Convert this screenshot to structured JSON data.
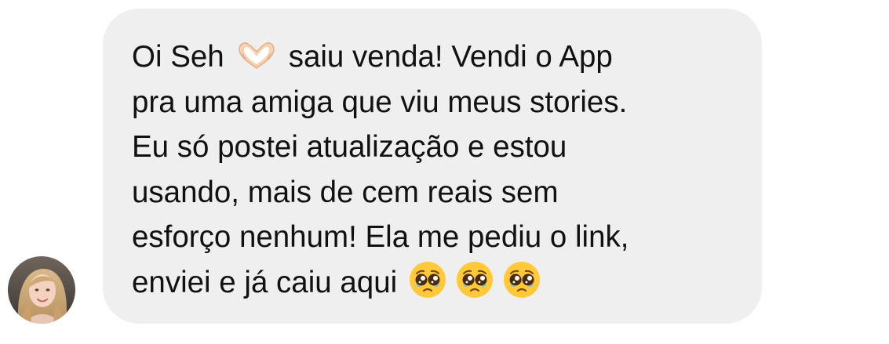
{
  "message": {
    "lines": [
      {
        "segments": [
          {
            "type": "text",
            "value": "Oi Seh"
          },
          {
            "type": "emoji",
            "icon": "heart-hands-icon"
          },
          {
            "type": "text",
            "value": "saiu venda! Vendi o App"
          }
        ]
      },
      {
        "segments": [
          {
            "type": "text",
            "value": "pra uma amiga que viu meus stories."
          }
        ]
      },
      {
        "segments": [
          {
            "type": "text",
            "value": "Eu só postei atualização e estou"
          }
        ]
      },
      {
        "segments": [
          {
            "type": "text",
            "value": "usando, mais de cem reais sem"
          }
        ]
      },
      {
        "segments": [
          {
            "type": "text",
            "value": "esforço nenhum! Ela me pediu o link,"
          }
        ]
      },
      {
        "segments": [
          {
            "type": "text",
            "value": "enviei e já caiu aqui"
          },
          {
            "type": "emoji",
            "icon": "pleading-face-icon"
          },
          {
            "type": "emoji",
            "icon": "pleading-face-icon"
          },
          {
            "type": "emoji",
            "icon": "pleading-face-icon"
          }
        ]
      }
    ]
  },
  "colors": {
    "bubble": "#efeff0",
    "text": "#111111",
    "background": "#ffffff"
  },
  "avatar": {
    "icon": "profile-photo-avatar"
  }
}
